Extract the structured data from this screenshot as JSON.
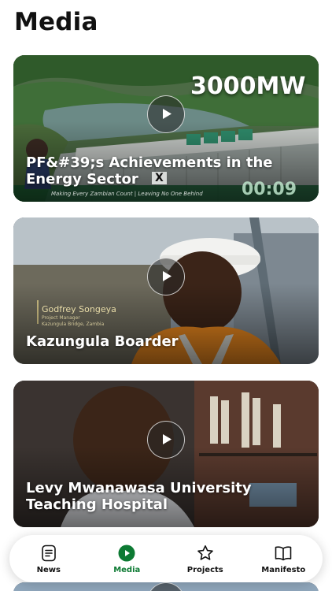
{
  "page": {
    "title": "Media"
  },
  "videos": [
    {
      "title": "PF&#39;s Achievements in the Energy Sector",
      "overlay_big": "3000MW",
      "overlay_duration": "00:09",
      "overlay_tagline": "Making Every Zambian Count | Leaving No One Behind",
      "overlay_x": "X",
      "play_icon": "play-icon"
    },
    {
      "title": "Kazungula Boarder",
      "overlay_name": "Godfrey Songeya",
      "overlay_role": "Project Manager",
      "overlay_place": "Kazungula Bridge, Zambia",
      "play_icon": "play-icon"
    },
    {
      "title": "Levy Mwanawasa University Teaching Hospital",
      "play_icon": "play-icon"
    }
  ],
  "tabbar": {
    "active_color": "#0d7a33",
    "items": [
      {
        "label": "News",
        "icon": "news-icon"
      },
      {
        "label": "Media",
        "icon": "media-play-icon"
      },
      {
        "label": "Projects",
        "icon": "star-icon"
      },
      {
        "label": "Manifesto",
        "icon": "book-icon"
      }
    ]
  }
}
